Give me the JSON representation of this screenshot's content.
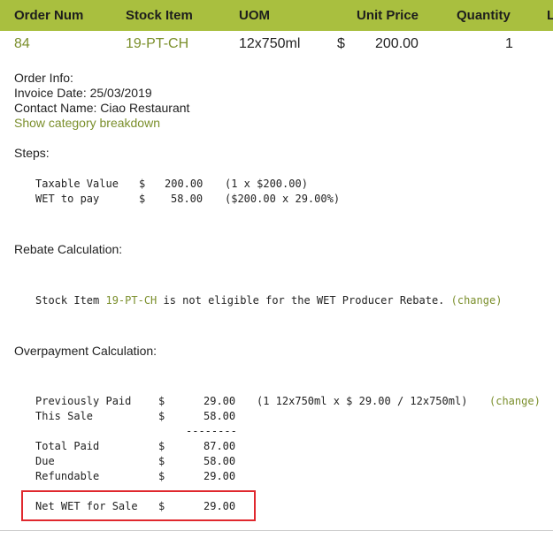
{
  "table": {
    "headers": [
      "Order Num",
      "Stock Item",
      "UOM",
      "Unit Price",
      "Quantity",
      "L"
    ],
    "row": {
      "order_num": "84",
      "stock_item": "19-PT-CH",
      "uom": "12x750ml",
      "currency": "$",
      "unit_price": "200.00",
      "quantity": "1"
    }
  },
  "order_info": {
    "heading": "Order Info:",
    "invoice_date": "Invoice Date: 25/03/2019",
    "contact_name": "Contact Name: Ciao Restaurant",
    "breakdown_link": "Show category breakdown"
  },
  "steps": {
    "heading": "Steps:",
    "taxable_label": "Taxable Value",
    "taxable_currency": "$",
    "taxable_amount": "200.00",
    "taxable_note": "(1 x $200.00)",
    "wet_label": "WET to pay",
    "wet_currency": "$",
    "wet_amount": "58.00",
    "wet_note": "($200.00 x 29.00%)"
  },
  "rebate": {
    "heading": "Rebate Calculation:",
    "prefix": "Stock Item ",
    "item_link": "19-PT-CH",
    "suffix": " is not eligible for the WET Producer Rebate. ",
    "change_link": "(change)"
  },
  "overpayment": {
    "heading": "Overpayment Calculation:",
    "rows": [
      {
        "label": "Previously Paid",
        "currency": "$",
        "amount": "29.00"
      },
      {
        "label": "This Sale",
        "currency": "$",
        "amount": "58.00"
      },
      {
        "label": "Total Paid",
        "currency": "$",
        "amount": "87.00"
      },
      {
        "label": "Due",
        "currency": "$",
        "amount": "58.00"
      },
      {
        "label": "Refundable",
        "currency": "$",
        "amount": "29.00"
      },
      {
        "label": "Net WET for Sale",
        "currency": "$",
        "amount": "29.00"
      }
    ],
    "previously_note": "(1 12x750ml x $ 29.00 / 12x750ml)",
    "change_link": "(change)",
    "separator": "--------"
  }
}
